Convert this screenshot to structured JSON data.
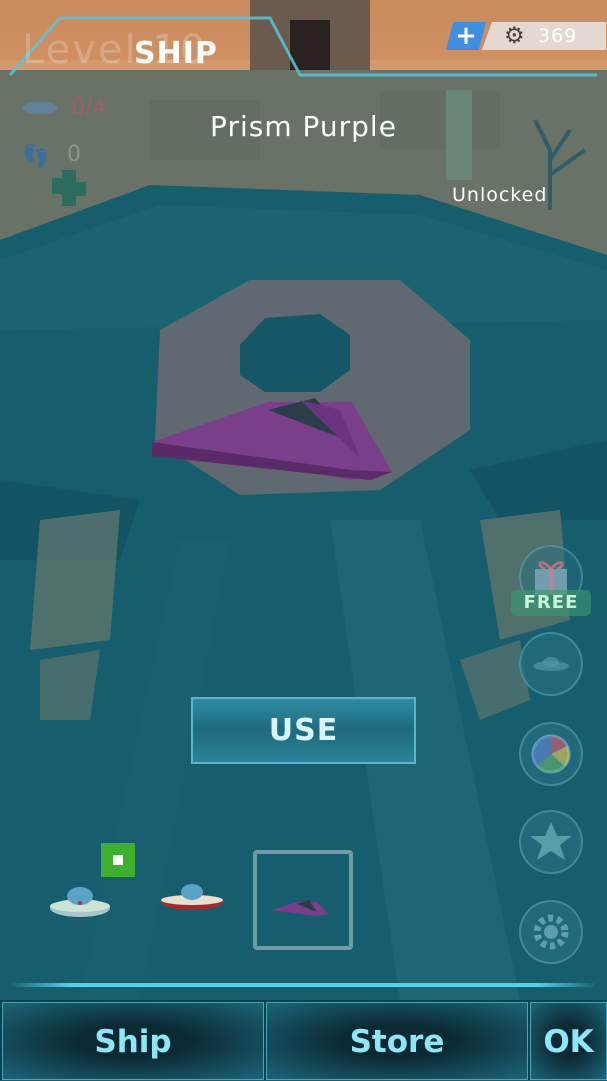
{
  "header": {
    "title": "SHIP",
    "level_text": "Level 10",
    "currency": {
      "amount": "369",
      "add_icon": "plus-icon",
      "gear_icon": "gear-icon"
    }
  },
  "stats": {
    "ufo": "0/4",
    "footprints": "0"
  },
  "ship": {
    "name": "Prism Purple",
    "status": "Unlocked"
  },
  "use_button": {
    "label": "USE"
  },
  "side_menu": {
    "gift": {
      "free_label": "FREE",
      "icon": "gift-icon"
    },
    "icons": [
      "ship-icon",
      "spin-wheel-icon",
      "star-icon",
      "settings-gear-icon"
    ]
  },
  "ship_slots": [
    {
      "name": "ufo-classic",
      "selected": false,
      "in_use": true
    },
    {
      "name": "ufo-red",
      "selected": false,
      "in_use": false
    },
    {
      "name": "prism-purple",
      "selected": true,
      "in_use": false
    }
  ],
  "bottom_tabs": {
    "ship": "Ship",
    "store": "Store",
    "ok": "OK"
  },
  "colors": {
    "accent": "#5ad0e6",
    "tab_text": "#8fe6f7",
    "purple_ship": "#7a3e8a",
    "badge_green": "#3db02d"
  }
}
